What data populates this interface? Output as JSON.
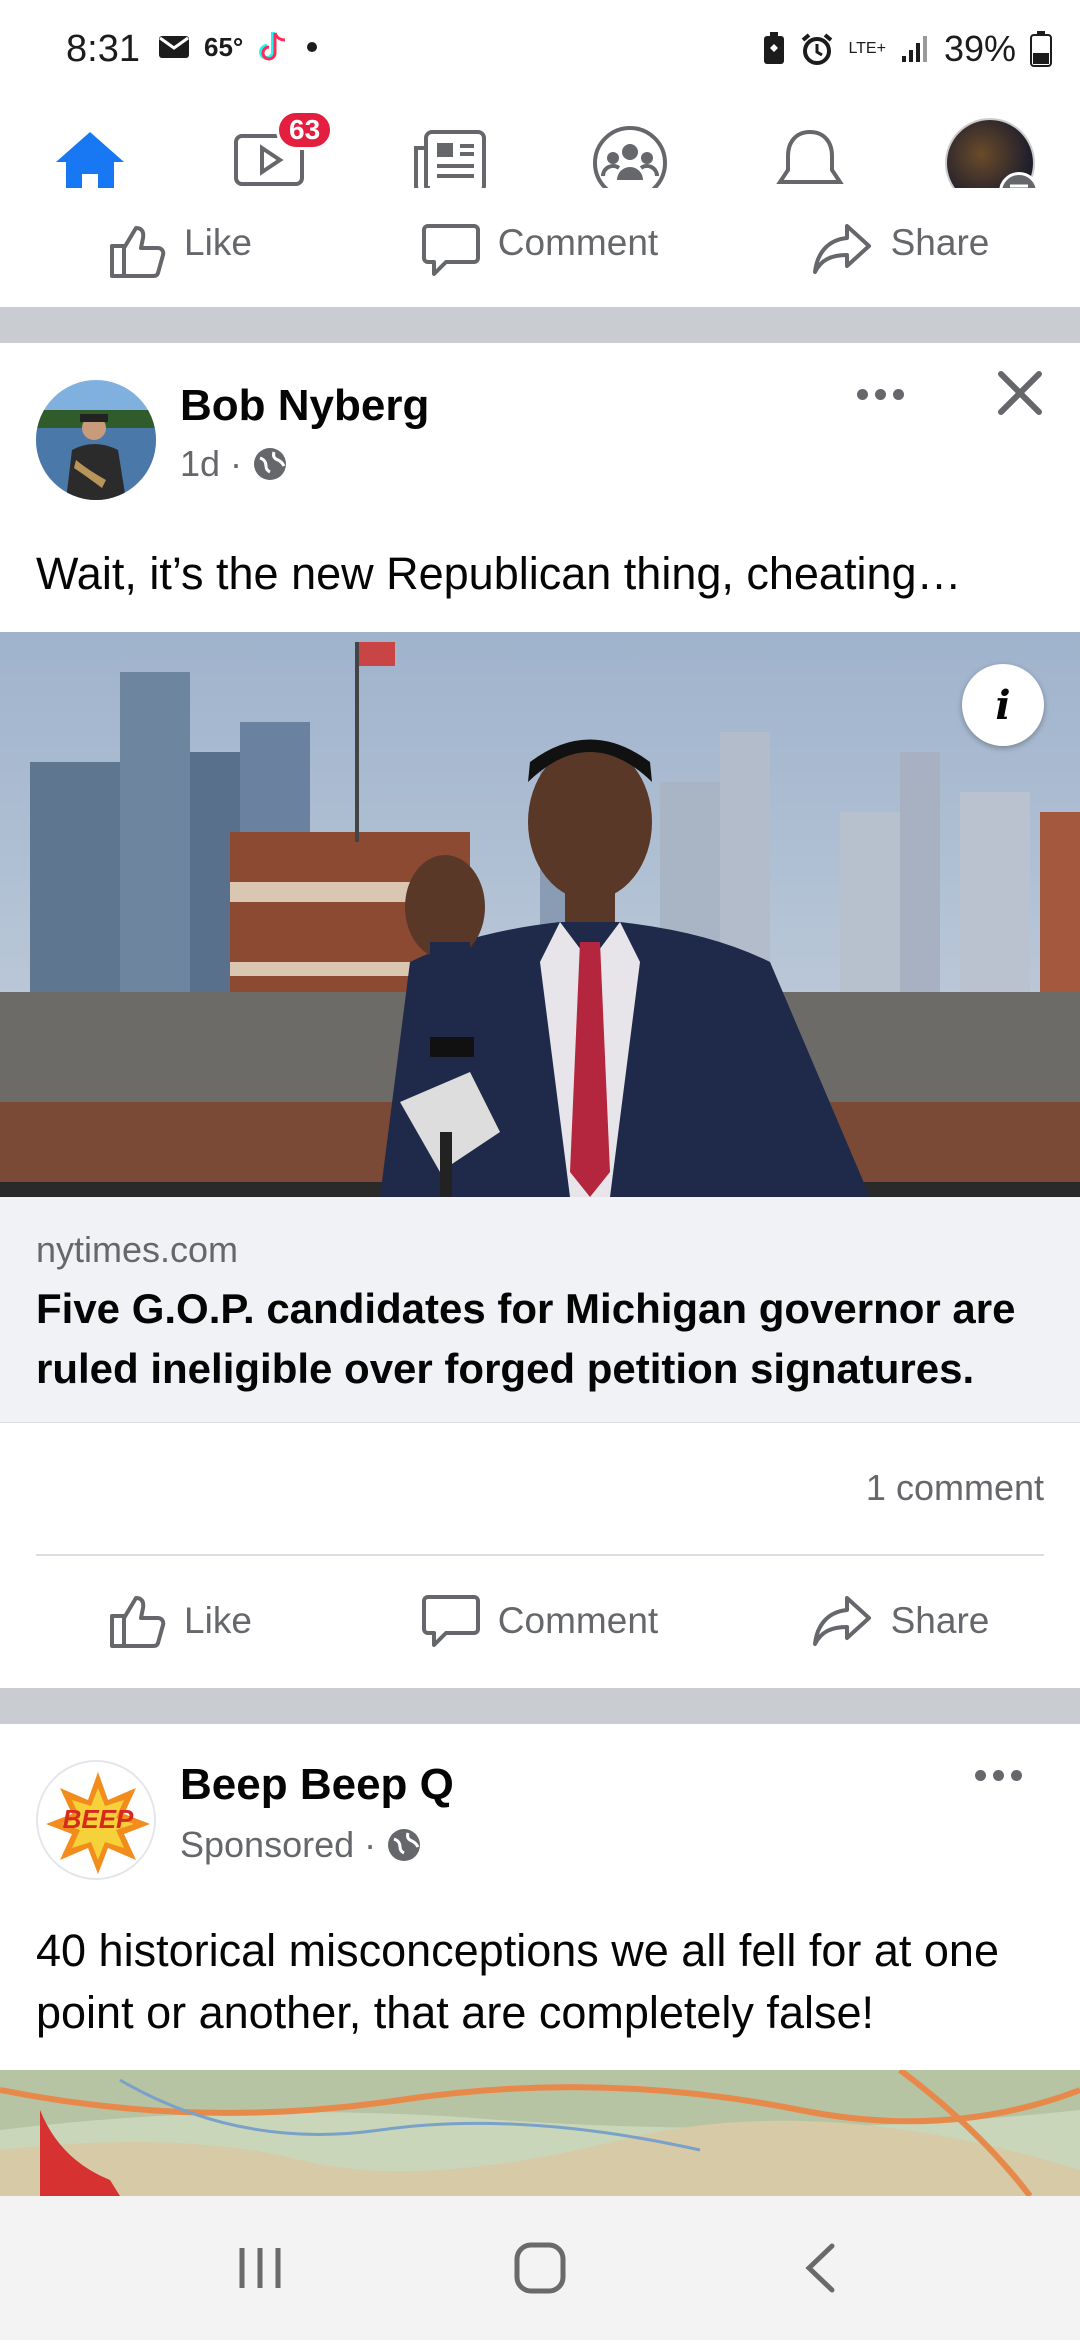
{
  "status_bar": {
    "time": "8:31",
    "temperature": "65°",
    "network": "LTE+",
    "battery": "39%"
  },
  "top_nav": {
    "items": [
      {
        "name": "home",
        "icon": "home-icon",
        "active": true
      },
      {
        "name": "watch",
        "icon": "video-icon",
        "badge": "63"
      },
      {
        "name": "news",
        "icon": "newspaper-icon"
      },
      {
        "name": "groups",
        "icon": "groups-icon"
      },
      {
        "name": "notifications",
        "icon": "bell-icon"
      },
      {
        "name": "menu",
        "icon": "profile-menu-icon"
      }
    ],
    "accent_color": "#1877f2",
    "badge_color": "#e41e3f"
  },
  "actions": {
    "like": "Like",
    "comment": "Comment",
    "share": "Share"
  },
  "post1": {
    "author": "Bob Nyberg",
    "time": "1d",
    "separator": "·",
    "text": "Wait, it’s the new Republican thing, cheating…",
    "info_label": "i",
    "link": {
      "domain": "nytimes.com",
      "title": "Five G.O.P. candidates for Michigan governor are ruled ineligible over forged petition signatures."
    },
    "comment_count": "1 comment"
  },
  "post2": {
    "author": "Beep Beep Q",
    "sponsored": "Sponsored",
    "separator": "·",
    "avatar_text": "BEEP",
    "text": "40 historical misconceptions we all fell for at one point or another, that are completely false!"
  }
}
